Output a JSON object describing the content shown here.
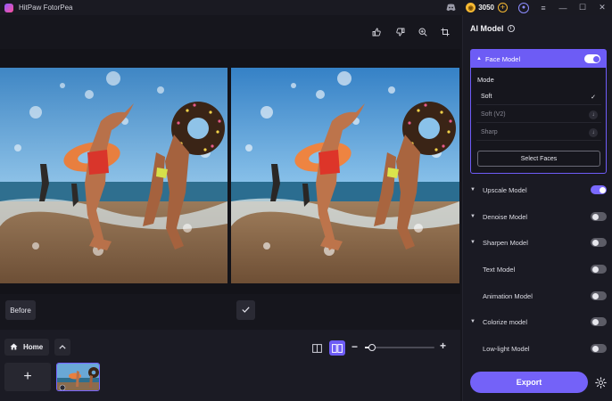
{
  "app": {
    "title": "HitPaw FotorPea"
  },
  "titlebar": {
    "credits": "3050",
    "icons": [
      "discord-icon",
      "coin-icon",
      "add-credits-icon",
      "user-icon",
      "menu-icon",
      "minimize-icon",
      "maximize-icon",
      "close-icon"
    ]
  },
  "toolbar": {
    "icons": [
      "thumbs-up-icon",
      "thumbs-down-icon",
      "zoom-in-icon",
      "crop-icon"
    ]
  },
  "canvas": {
    "before_label": "Before",
    "confirm_icon": "check-icon"
  },
  "bottom": {
    "home_label": "Home",
    "add_icon": "plus-icon",
    "view_modes": [
      "single-view-icon",
      "split-view-icon"
    ],
    "active_view": "split-view-icon",
    "zoom_level": 0.1
  },
  "panel": {
    "title": "AI Model",
    "face_model": {
      "label": "Face Model",
      "enabled": true,
      "mode_label": "Mode",
      "options": [
        {
          "label": "Soft",
          "selected": true,
          "mark": "✓"
        },
        {
          "label": "Soft (V2)",
          "selected": false,
          "mark": "↓"
        },
        {
          "label": "Sharp",
          "selected": false,
          "mark": "↓"
        }
      ],
      "select_faces_label": "Select Faces"
    },
    "models": [
      {
        "label": "Upscale Model",
        "expandable": true,
        "enabled": true
      },
      {
        "label": "Denoise Model",
        "expandable": true,
        "enabled": false
      },
      {
        "label": "Sharpen Model",
        "expandable": true,
        "enabled": false
      },
      {
        "label": "Text Model",
        "expandable": false,
        "enabled": false
      },
      {
        "label": "Animation Model",
        "expandable": false,
        "enabled": false
      },
      {
        "label": "Colorize model",
        "expandable": true,
        "enabled": false
      },
      {
        "label": "Low-light Model",
        "expandable": false,
        "enabled": false
      }
    ],
    "export_label": "Export"
  },
  "colors": {
    "accent": "#6d5cf5",
    "background": "#16161d",
    "panel": "#1a1a23"
  }
}
